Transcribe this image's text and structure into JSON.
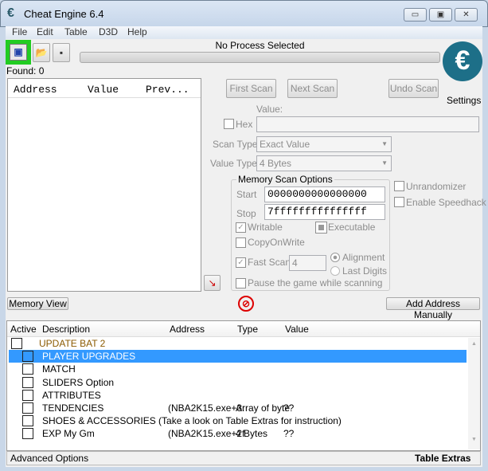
{
  "window": {
    "title": "Cheat Engine 6.4",
    "minimize": "▭",
    "maximize": "▣",
    "close": "✕"
  },
  "menu": [
    "File",
    "Edit",
    "Table",
    "D3D",
    "Help"
  ],
  "toolbar": {
    "process_status": "No Process Selected",
    "found": "Found: 0",
    "settings": "Settings",
    "logo_text": "Cheat Engine"
  },
  "results": {
    "columns": [
      "Address",
      "Value",
      "Prev..."
    ]
  },
  "scan": {
    "first": "First Scan",
    "next": "Next Scan",
    "undo": "Undo Scan",
    "value_label": "Value:",
    "hex": "Hex",
    "scan_type_label": "Scan Type",
    "scan_type": "Exact Value",
    "value_type_label": "Value Type",
    "value_type": "4 Bytes",
    "mem_options": "Memory Scan Options",
    "start_label": "Start",
    "start": "0000000000000000",
    "stop_label": "Stop",
    "stop": "7fffffffffffffff",
    "writable": "Writable",
    "executable": "Executable",
    "copyonwrite": "CopyOnWrite",
    "fastscan": "Fast Scan",
    "fastscan_value": "4",
    "alignment": "Alignment",
    "lastdigits": "Last Digits",
    "pause": "Pause the game while scanning",
    "unrandomizer": "Unrandomizer",
    "speedhack": "Enable Speedhack"
  },
  "buttons": {
    "memory_view": "Memory View",
    "add_address": "Add Address Manually"
  },
  "table": {
    "columns": [
      "Active",
      "Description",
      "Address",
      "Type",
      "Value"
    ],
    "rows": [
      {
        "desc": "UPDATE BAT 2",
        "address": "",
        "type": "",
        "value": ""
      },
      {
        "desc": "PLAYER UPGRADES",
        "address": "",
        "type": "",
        "value": ""
      },
      {
        "desc": "MATCH",
        "address": "",
        "type": "",
        "value": ""
      },
      {
        "desc": "SLIDERS Option",
        "address": "",
        "type": "",
        "value": ""
      },
      {
        "desc": "ATTRIBUTES",
        "address": "",
        "type": "",
        "value": ""
      },
      {
        "desc": "TENDENCIES",
        "address": "(NBA2K15.exe+3:",
        "type": "Array of byte",
        "value": "??"
      },
      {
        "desc": "SHOES & ACCESSORIES (Take a look on Table Extras for instruction)",
        "address": "",
        "type": "",
        "value": ""
      },
      {
        "desc": "EXP My Gm",
        "address": "(NBA2K15.exe+2f",
        "type": "4 Bytes",
        "value": "??"
      }
    ]
  },
  "footer": {
    "advanced": "Advanced Options",
    "extras": "Table Extras"
  },
  "colors": {
    "selection": "#3399ff",
    "group_text": "#8b5a00",
    "highlight": "#22cc22"
  }
}
